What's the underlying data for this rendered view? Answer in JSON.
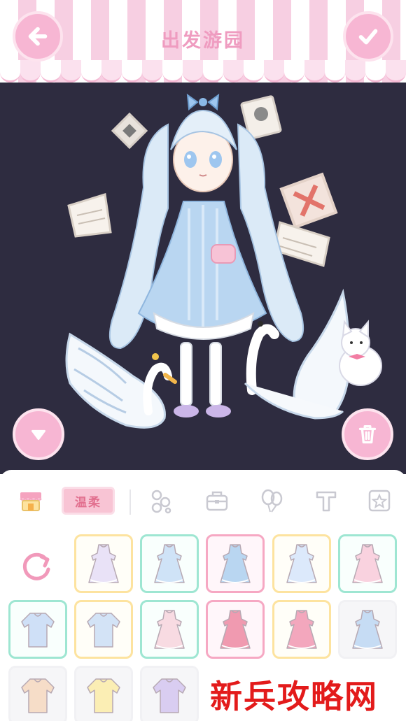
{
  "header": {
    "title": "出发游园",
    "back_icon": "arrow-left-icon",
    "confirm_icon": "check-icon"
  },
  "stage": {
    "collapse_icon": "triangle-down-icon",
    "delete_icon": "trash-icon"
  },
  "tabs": {
    "shop_icon": "shop-icon",
    "style_tag": "温柔",
    "items": [
      "flower-accessory-icon",
      "bag-icon",
      "balloon-icon",
      "text-icon",
      "star-frame-icon"
    ]
  },
  "grid": {
    "reset_icon": "refresh-icon",
    "items": [
      {
        "name": "lavender-dress",
        "border": "yellow",
        "color": "#e9e2f7"
      },
      {
        "name": "blue-cami-dress",
        "border": "mint",
        "color": "#cfe3f7"
      },
      {
        "name": "blue-lolita-dress",
        "border": "pink",
        "color": "#b9d6f1"
      },
      {
        "name": "light-blue-gown",
        "border": "yellow",
        "color": "#dce9fb"
      },
      {
        "name": "pink-gown",
        "border": "mint",
        "color": "#f9d2df"
      },
      {
        "name": "blue-blouse-skirt",
        "border": "mint",
        "color": "#cfe0f7"
      },
      {
        "name": "blue-cardigan",
        "border": "yellow",
        "color": "#d3e3f6"
      },
      {
        "name": "pink-sweater-dress",
        "border": "mint",
        "color": "#f8dbe2"
      },
      {
        "name": "red-sweater-dress",
        "border": "pink",
        "color": "#f09ab0"
      },
      {
        "name": "rose-ruffle-dress",
        "border": "yellow",
        "color": "#f3a7bd"
      },
      {
        "name": "blue-slip-dress",
        "border": "none",
        "color": "#c6dcf4"
      },
      {
        "name": "peach-cardigan",
        "border": "none",
        "color": "#f6ddc8"
      },
      {
        "name": "yellow-blouse",
        "border": "none",
        "color": "#fbeeb4"
      },
      {
        "name": "lilac-cardigan",
        "border": "none",
        "color": "#d9cdf1"
      }
    ]
  },
  "watermark": "新兵攻略网"
}
